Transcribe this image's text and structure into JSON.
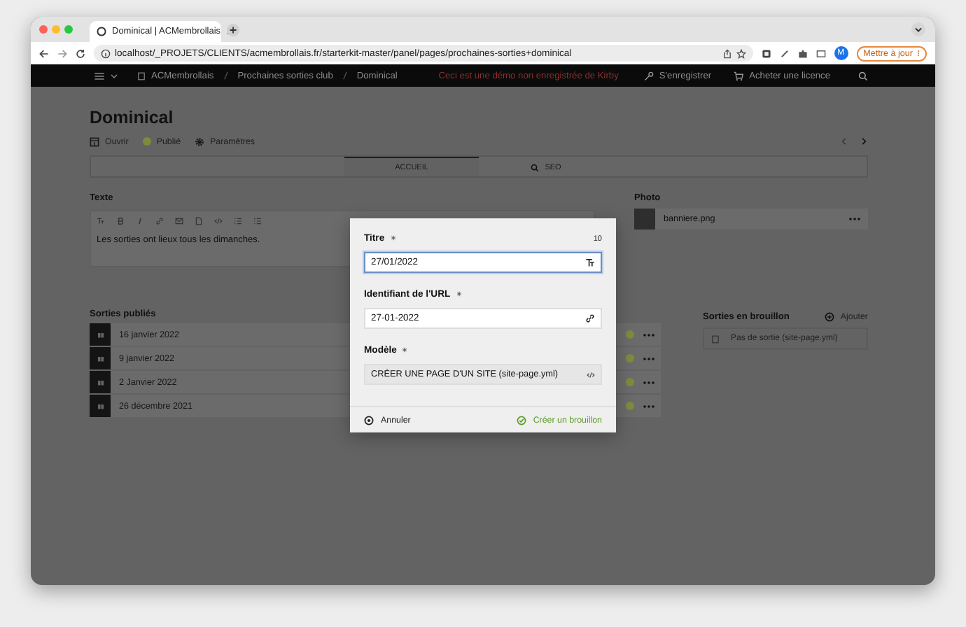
{
  "browser": {
    "tab_title": "Dominical | ACMembrollais",
    "url": "localhost/_PROJETS/CLIENTS/acmembrollais.fr/starterkit-master/panel/pages/prochaines-sorties+dominical",
    "avatar": "M",
    "update_button": "Mettre à jour"
  },
  "topbar": {
    "breadcrumbs": [
      "ACMembrollais",
      "Prochaines sorties club",
      "Dominical"
    ],
    "demo_notice": "Ceci est une démo non enregistrée de Kirby",
    "register": "S'enregistrer",
    "buy": "Acheter une licence"
  },
  "page": {
    "title": "Dominical",
    "actions": [
      {
        "kind": "open",
        "label": "Ouvrir"
      },
      {
        "kind": "status",
        "label": "Publié",
        "color": "#7d8c3c"
      },
      {
        "kind": "settings",
        "label": "Paramètres"
      }
    ],
    "tabs": [
      {
        "kind": "plain",
        "label": "ACCUEIL",
        "selected": true
      },
      {
        "kind": "search",
        "label": "SEO",
        "selected": false
      }
    ],
    "text_field": {
      "label": "Texte",
      "toolbar": [
        {
          "kind": "headings"
        },
        {
          "kind": "bold"
        },
        {
          "kind": "italic"
        },
        {
          "kind": "link"
        },
        {
          "kind": "email"
        },
        {
          "kind": "file"
        },
        {
          "kind": "code"
        },
        {
          "kind": "ul"
        },
        {
          "kind": "ol"
        }
      ],
      "content": "Les sorties ont lieux tous les dimanches."
    },
    "photo_field": {
      "label": "Photo",
      "file": "banniere.png"
    },
    "published": {
      "title": "Sorties publiés",
      "items": [
        {
          "title": "16 janvier 2022",
          "color": "#7d8c3c"
        },
        {
          "title": "9 janvier 2022",
          "color": "#7d8c3c"
        },
        {
          "title": "2 Janvier 2022",
          "color": "#7d8c3c"
        },
        {
          "title": "26 décembre 2021",
          "color": "#7d8c3c"
        }
      ]
    },
    "drafts": {
      "title": "Sorties en brouillon",
      "add": "Ajouter",
      "empty": "Pas de sortie (site-page.yml)"
    }
  },
  "dialog": {
    "fields": [
      {
        "kind": "text",
        "label": "Titre",
        "required": true,
        "counter": "10",
        "value": "27/01/2022",
        "focused": true
      },
      {
        "kind": "slug",
        "label": "Identifiant de l'URL",
        "required": true,
        "value": "27-01-2022",
        "focused": false
      },
      {
        "kind": "template",
        "label": "Modèle",
        "required": true,
        "value": "CRÉER UNE PAGE D'UN SITE (site-page.yml)",
        "focused": false
      }
    ],
    "cancel": "Annuler",
    "submit": "Créer un brouillon"
  }
}
